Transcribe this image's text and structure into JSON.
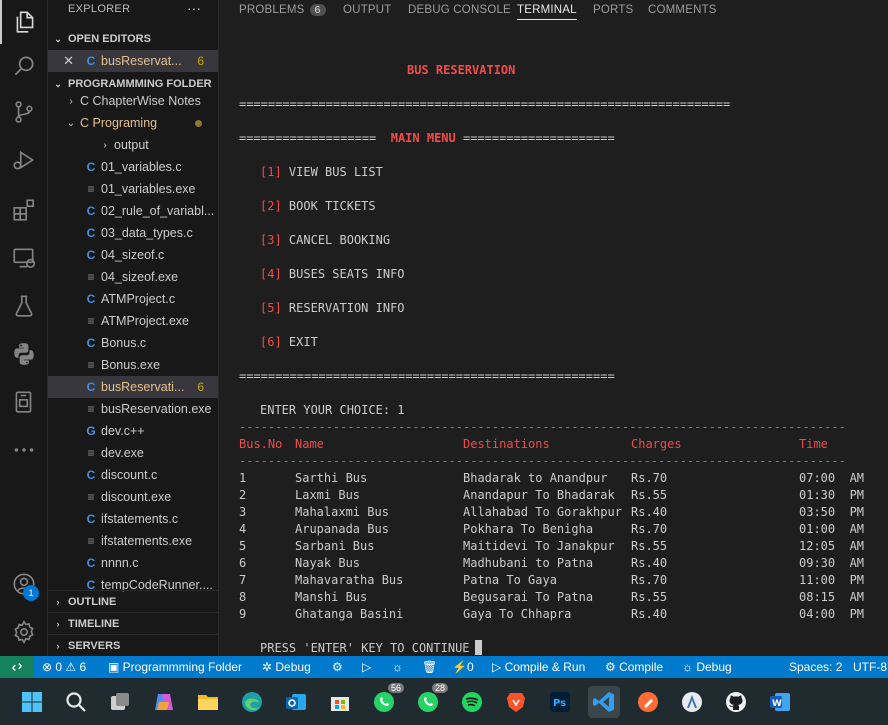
{
  "sidebar": {
    "title": "EXPLORER",
    "more": "···",
    "open_editors": {
      "label": "OPEN EDITORS",
      "file": "busReservat...",
      "count": "6"
    },
    "folder": {
      "label": "PROGRAMMMING FOLDER",
      "items": [
        {
          "name": "C ChapterWise Notes",
          "kind": "folder"
        },
        {
          "name": "C Programing",
          "kind": "folder-open"
        },
        {
          "name": "output",
          "kind": "folder"
        },
        {
          "name": "01_variables.c",
          "kind": "c"
        },
        {
          "name": "01_variables.exe",
          "kind": "exe"
        },
        {
          "name": "02_rule_of_variabl...",
          "kind": "c"
        },
        {
          "name": "03_data_types.c",
          "kind": "c"
        },
        {
          "name": "04_sizeof.c",
          "kind": "c"
        },
        {
          "name": "04_sizeof.exe",
          "kind": "exe"
        },
        {
          "name": "ATMProject.c",
          "kind": "c"
        },
        {
          "name": "ATMProject.exe",
          "kind": "exe"
        },
        {
          "name": "Bonus.c",
          "kind": "c"
        },
        {
          "name": "Bonus.exe",
          "kind": "exe"
        },
        {
          "name": "busReservati...",
          "kind": "c",
          "count": "6"
        },
        {
          "name": "busReservation.exe",
          "kind": "exe"
        },
        {
          "name": "dev.c++",
          "kind": "cpp"
        },
        {
          "name": "dev.exe",
          "kind": "exe"
        },
        {
          "name": "discount.c",
          "kind": "c"
        },
        {
          "name": "discount.exe",
          "kind": "exe"
        },
        {
          "name": "ifstatements.c",
          "kind": "c"
        },
        {
          "name": "ifstatements.exe",
          "kind": "exe"
        },
        {
          "name": "nnnn.c",
          "kind": "c"
        },
        {
          "name": "tempCodeRunner....",
          "kind": "c"
        }
      ]
    },
    "outline": "OUTLINE",
    "timeline": "TIMELINE",
    "servers": "SERVERS"
  },
  "activity_icons": [
    "files-icon",
    "search-icon",
    "source-control-icon",
    "run-debug-icon",
    "extensions-icon",
    "remote-explorer-icon",
    "testing-icon",
    "python-icon",
    "docker-icon",
    "more-icon",
    "account-icon",
    "settings-gear-icon"
  ],
  "account_badge": "1",
  "panel_tabs": {
    "problems": "PROBLEMS",
    "problems_count": "6",
    "output": "OUTPUT",
    "debug_console": "DEBUG CONSOLE",
    "terminal": "TERMINAL",
    "ports": "PORTS",
    "comments": "COMMENTS"
  },
  "terminal": {
    "title": "BUS RESERVATION",
    "rule_long": "====================================================================",
    "menu_left": "===================",
    "menu_title": "MAIN MENU",
    "menu_right": "=====================",
    "menu": [
      {
        "num": "[1]",
        "label": "VIEW BUS LIST"
      },
      {
        "num": "[2]",
        "label": "BOOK TICKETS"
      },
      {
        "num": "[3]",
        "label": "CANCEL BOOKING"
      },
      {
        "num": "[4]",
        "label": "BUSES SEATS INFO"
      },
      {
        "num": "[5]",
        "label": "RESERVATION INFO"
      },
      {
        "num": "[6]",
        "label": "EXIT"
      }
    ],
    "rule_short": "====================================================",
    "choice_prompt": "ENTER YOUR CHOICE: 1",
    "dash_rule": "------------------------------------------------------------------------------------",
    "headers": {
      "busno": "Bus.No",
      "name": "Name",
      "dest": "Destinations",
      "charges": "Charges",
      "time": "Time"
    },
    "buses": [
      {
        "no": "1",
        "name": "Sarthi Bus",
        "dest": "Bhadarak to Anandpur",
        "charge": "Rs.70",
        "time": "07:00  AM"
      },
      {
        "no": "2",
        "name": "Laxmi Bus",
        "dest": "Anandapur To Bhadarak",
        "charge": "Rs.55",
        "time": "01:30  PM"
      },
      {
        "no": "3",
        "name": "Mahalaxmi Bus",
        "dest": "Allahabad To Gorakhpur",
        "charge": "Rs.40",
        "time": "03:50  PM"
      },
      {
        "no": "4",
        "name": "Arupanada Bus",
        "dest": "Pokhara To Benigha",
        "charge": "Rs.70",
        "time": "01:00  AM"
      },
      {
        "no": "5",
        "name": "Sarbani Bus",
        "dest": "Maitidevi To Janakpur",
        "charge": "Rs.55",
        "time": "12:05  AM"
      },
      {
        "no": "6",
        "name": "Nayak Bus",
        "dest": "Madhubani to Patna",
        "charge": "Rs.40",
        "time": "09:30  AM"
      },
      {
        "no": "7",
        "name": "Mahavaratha Bus",
        "dest": "Patna To Gaya",
        "charge": "Rs.70",
        "time": "11:00  PM"
      },
      {
        "no": "8",
        "name": "Manshi Bus",
        "dest": "Begusarai To Patna",
        "charge": "Rs.55",
        "time": "08:15  AM"
      },
      {
        "no": "9",
        "name": "Ghatanga Basini",
        "dest": "Gaya To Chhapra",
        "charge": "Rs.40",
        "time": "04:00  PM"
      }
    ],
    "continue_prompt": "PRESS 'ENTER' KEY TO CONTINUE"
  },
  "status": {
    "errors": "0",
    "warnings": "6",
    "folder": "Programmming Folder",
    "debug": "Debug",
    "ports": "0",
    "compile_run": "Compile & Run",
    "compile": "Compile",
    "debug2": "Debug",
    "spaces": "Spaces: 2",
    "encoding": "UTF-8"
  },
  "taskbar": {
    "whatsapp1_badge": "56",
    "whatsapp2_badge": "28"
  },
  "colors": {
    "accent": "#007acc",
    "remote": "#16825d",
    "terminal_red": "#f14c4c"
  }
}
